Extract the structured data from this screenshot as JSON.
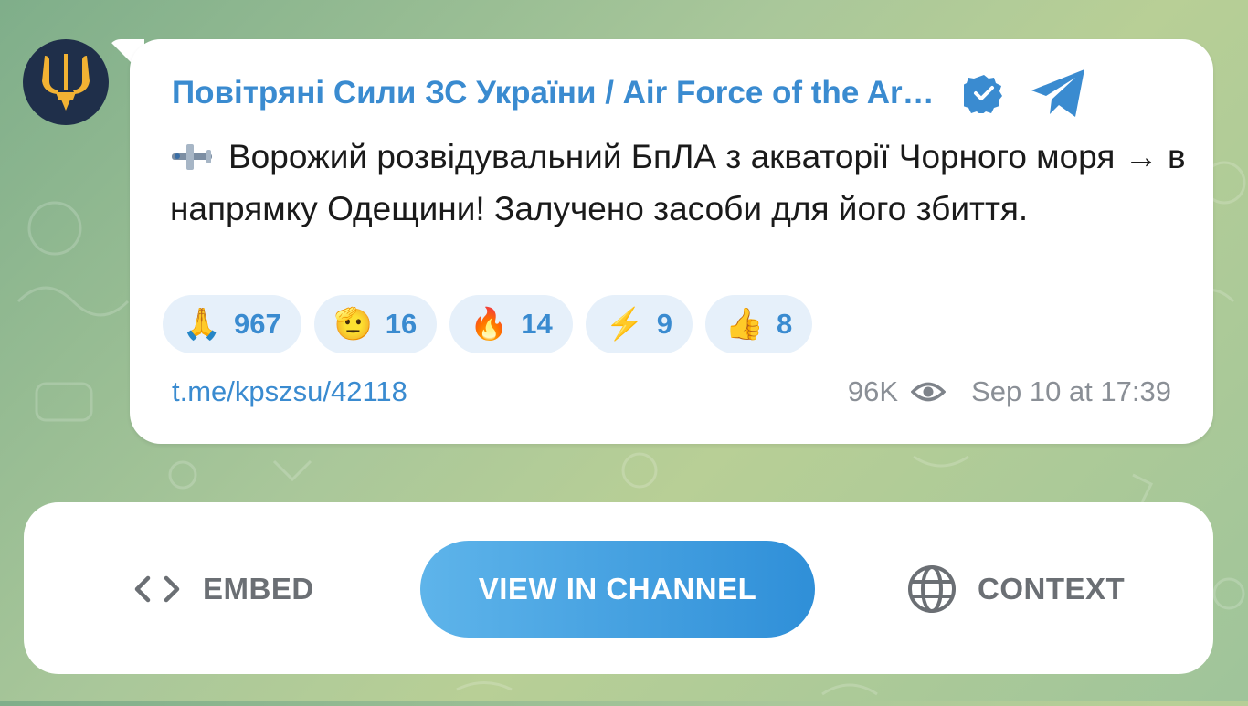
{
  "channel": {
    "name": "Повітряні Сили ЗС України / Air Force of the Ar…",
    "verified_icon": "verified-badge-icon",
    "avatar_icon": "trident-icon",
    "platform_icon": "telegram-icon"
  },
  "message": {
    "icon": "airplane-emoji",
    "text": "Ворожий розвідувальний БпЛА з акваторії Чорного моря → в напрямку Одещини! Залучено засоби для його збиття."
  },
  "reactions": [
    {
      "emoji": "🙏",
      "icon": "folded-hands-emoji",
      "count": "967"
    },
    {
      "emoji": "🫡",
      "icon": "salute-emoji",
      "count": "16"
    },
    {
      "emoji": "🔥",
      "icon": "fire-emoji",
      "count": "14"
    },
    {
      "emoji": "⚡",
      "icon": "lightning-emoji",
      "count": "9"
    },
    {
      "emoji": "👍",
      "icon": "thumbs-up-emoji",
      "count": "8"
    }
  ],
  "meta": {
    "link": "t.me/kpszsu/42118",
    "views": "96K",
    "views_icon": "eye-icon",
    "timestamp": "Sep 10 at 17:39"
  },
  "actions": {
    "embed_label": "EMBED",
    "view_label": "VIEW IN CHANNEL",
    "context_label": "CONTEXT"
  },
  "colors": {
    "accent": "#3a8bd0",
    "button_gradient_start": "#5eb4ea",
    "button_gradient_end": "#2f8fd8",
    "avatar_bg": "#1f2f4a",
    "trident": "#f2b233"
  }
}
